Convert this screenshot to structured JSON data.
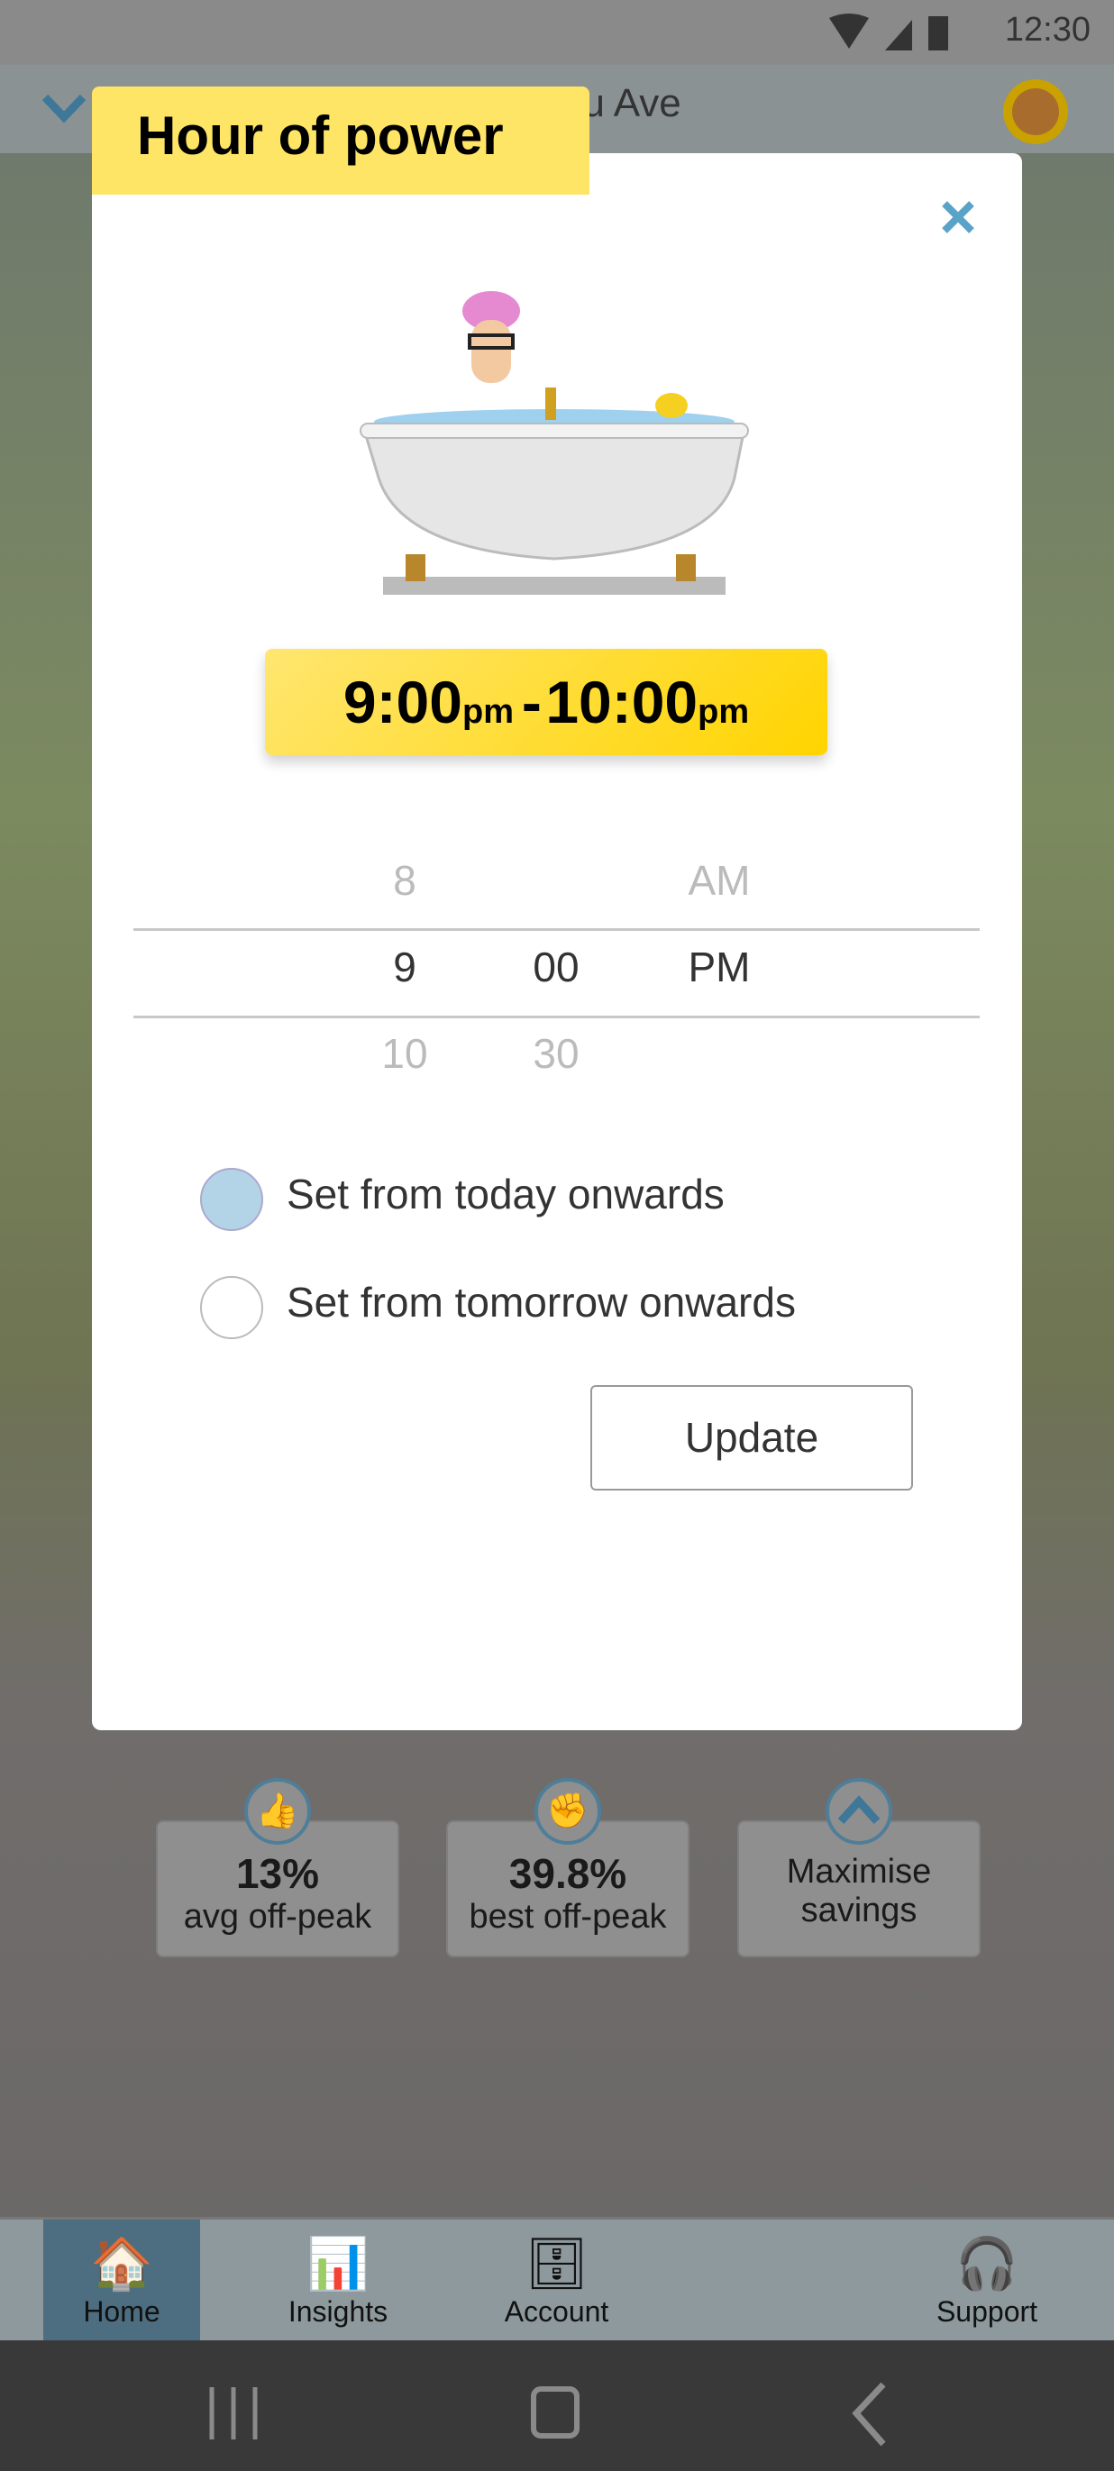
{
  "status": {
    "time": "12:30",
    "icons": [
      "wifi-icon",
      "signal-icon",
      "battery-icon"
    ]
  },
  "header": {
    "address": "tulu Ave",
    "avatar": "avatar-icon"
  },
  "modal": {
    "title": "Hour of power",
    "close_icon": "close-icon",
    "time_range": {
      "start": "9:00",
      "start_suffix": "pm",
      "separator": "-",
      "end": "10:00",
      "end_suffix": "pm"
    },
    "picker": {
      "hours": {
        "prev": "8",
        "selected": "9",
        "next": "10"
      },
      "minutes": {
        "selected": "00",
        "next": "30"
      },
      "period": {
        "prev": "AM",
        "selected": "PM"
      }
    },
    "options": [
      {
        "label": "Set from today onwards",
        "selected": true
      },
      {
        "label": "Set from tomorrow onwards",
        "selected": false
      }
    ],
    "update_label": "Update",
    "accent": "#ffe566",
    "radio_selected_color": "#b3d4e6",
    "close_color": "#5aa3c8"
  },
  "stats": [
    {
      "value": "13%",
      "label": "avg off-peak",
      "icon": "thumbs-up-icon"
    },
    {
      "value": "39.8%",
      "label": "best off-peak",
      "icon": "fist-icon"
    },
    {
      "label_line1": "Maximise",
      "label_line2": "savings",
      "icon": "chevron-up-icon"
    }
  ],
  "nav": [
    {
      "label": "Home",
      "active": true
    },
    {
      "label": "Insights"
    },
    {
      "label": "Account"
    },
    {
      "label": "Support"
    }
  ]
}
